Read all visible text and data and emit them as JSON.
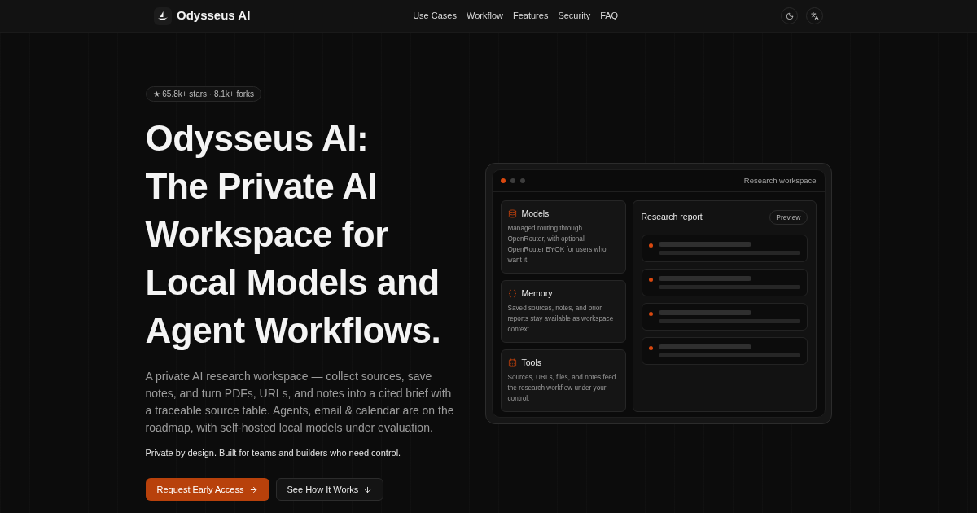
{
  "header": {
    "brand": "Odysseus AI",
    "nav": [
      "Use Cases",
      "Workflow",
      "Features",
      "Security",
      "FAQ"
    ]
  },
  "hero": {
    "badge": "★ 65.8k+ stars · 8.1k+ forks",
    "headline_lines": [
      "Odysseus AI:",
      "The Private AI",
      "Workspace for",
      "Local Models and",
      "Agent Workflows."
    ],
    "description": "A private AI research workspace — collect sources, save notes, and turn PDFs, URLs, and notes into a cited brief with a traceable source table. Agents, email & calendar are on the roadmap, with self-hosted local models under evaluation.",
    "tagline": "Private by design. Built for teams and builders who need control.",
    "buttons": [
      {
        "label": "Request Early Access",
        "kind": "primary"
      },
      {
        "label": "See How It Works",
        "kind": "secondary"
      }
    ]
  },
  "workspace": {
    "window_dots": [
      {
        "color": "#d9480f"
      },
      {
        "color": "#3d3d3d"
      },
      {
        "color": "#3d3d3d"
      }
    ],
    "title": "Research workspace",
    "cards": [
      {
        "title": "Models",
        "description": "Managed routing through OpenRouter, with optional OpenRouter BYOK for users who want it."
      },
      {
        "title": "Memory",
        "description": "Saved sources, notes, and prior reports stay available as workspace context."
      },
      {
        "title": "Tools",
        "description": "Sources, URLs, files, and notes feed the research workflow under your control."
      }
    ],
    "report": {
      "title": "Research report",
      "badge": "Preview"
    }
  }
}
